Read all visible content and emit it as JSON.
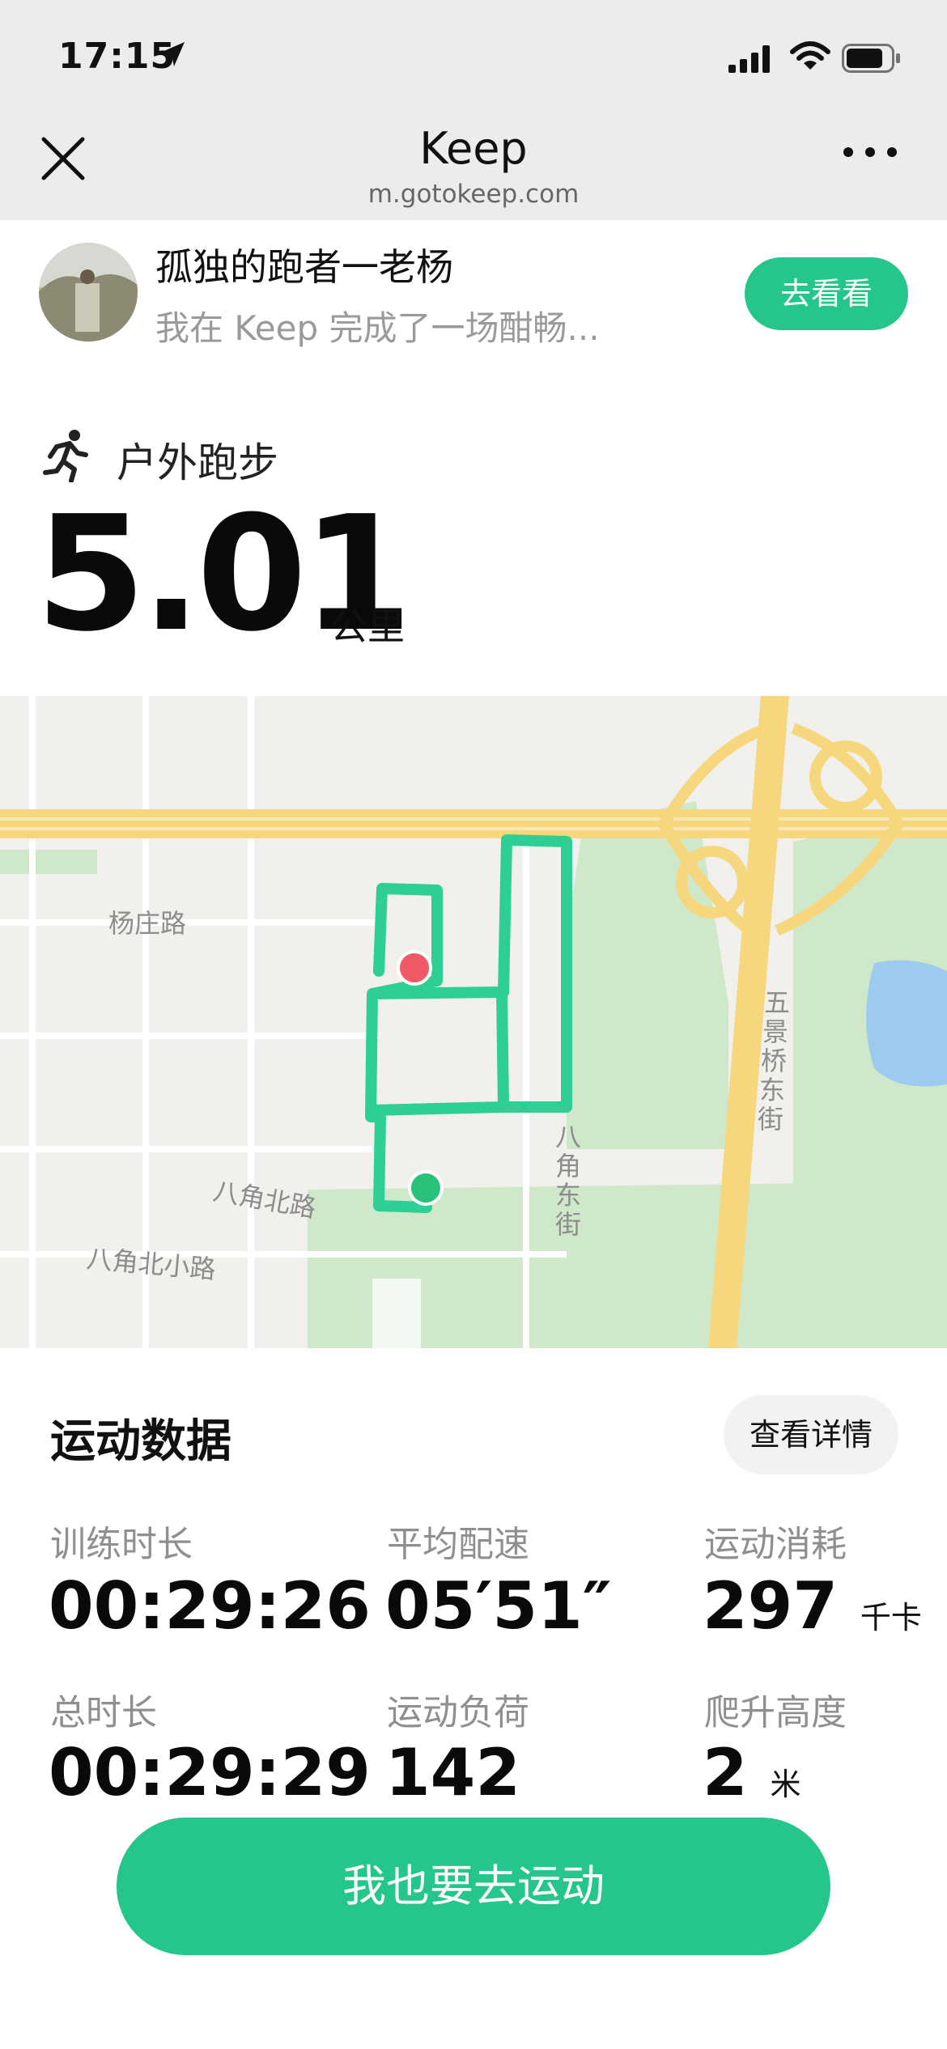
{
  "status_bar": {
    "time": "17:15"
  },
  "browser": {
    "title": "Keep",
    "url": "m.gotokeep.com"
  },
  "share": {
    "user_name": "孤独的跑者一老杨",
    "message": "我在 Keep 完成了一场酣畅...",
    "button_label": "去看看"
  },
  "activity": {
    "type": "户外跑步",
    "distance": "5.01",
    "distance_unit": "公里"
  },
  "map": {
    "road_labels": [
      "杨庄路",
      "八角北路",
      "八角北小路",
      "八角东街",
      "五景桥东街"
    ],
    "route_color": "#2ecf94",
    "start_color": "#28c27a",
    "end_color": "#ef5a66"
  },
  "stats": {
    "section_title": "运动数据",
    "detail_button": "查看详情",
    "items": [
      {
        "label": "训练时长",
        "value": "00:29:26",
        "unit": ""
      },
      {
        "label": "平均配速",
        "value": "05′51″",
        "unit": ""
      },
      {
        "label": "运动消耗",
        "value": "297",
        "unit": "千卡"
      },
      {
        "label": "总时长",
        "value": "00:29:29",
        "unit": ""
      },
      {
        "label": "运动负荷",
        "value": "142",
        "unit": ""
      },
      {
        "label": "爬升高度",
        "value": "2",
        "unit": "米"
      }
    ]
  },
  "cta": {
    "label": "我也要去运动"
  },
  "colors": {
    "accent": "#24c789",
    "browser_bar": "#ececec"
  }
}
